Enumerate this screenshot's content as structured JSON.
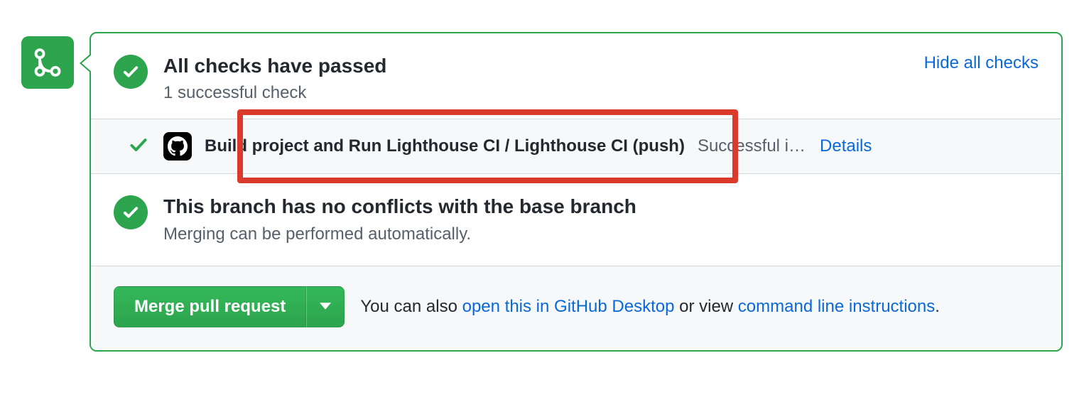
{
  "checks": {
    "title": "All checks have passed",
    "subtitle": "1 successful check",
    "hide_label": "Hide all checks",
    "items": [
      {
        "name": "Build project and Run Lighthouse CI / Lighthouse CI (push)",
        "status": "Successful i…",
        "details_label": "Details"
      }
    ]
  },
  "conflicts": {
    "title": "This branch has no conflicts with the base branch",
    "subtitle": "Merging can be performed automatically."
  },
  "merge": {
    "button_label": "Merge pull request",
    "help_prefix": "You can also ",
    "link_desktop": "open this in GitHub Desktop",
    "help_mid": " or view ",
    "link_cli": "command line instructions",
    "help_suffix": "."
  }
}
